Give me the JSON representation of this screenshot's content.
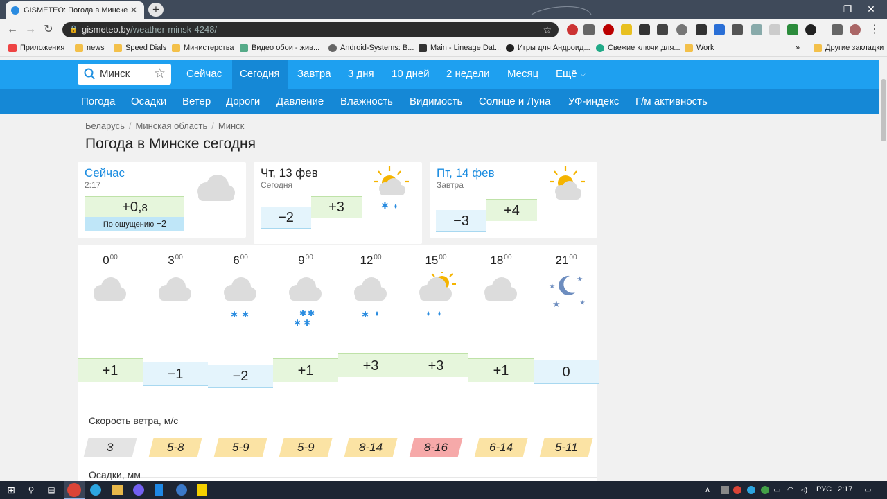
{
  "browser": {
    "tab_title": "GISMETEO: Погода в Минске сегодня",
    "url_host": "gismeteo.by",
    "url_path": "/weather-minsk-4248/",
    "bookmarks": [
      "Приложения",
      "news",
      "Speed Dials",
      "Министерства",
      "Видео обои - жив...",
      "Android-Systems: B...",
      "Main - Lineage Dat...",
      "Игры для Андроид...",
      "Свежие ключи для...",
      "Work"
    ],
    "other_bookmarks": "Другие закладки"
  },
  "site": {
    "search_value": "Минск",
    "top_nav": [
      "Сейчас",
      "Сегодня",
      "Завтра",
      "3 дня",
      "10 дней",
      "2 недели",
      "Месяц",
      "Ещё"
    ],
    "top_nav_active": "Сегодня",
    "sub_nav": [
      "Погода",
      "Осадки",
      "Ветер",
      "Дороги",
      "Давление",
      "Влажность",
      "Видимость",
      "Солнце и Луна",
      "УФ-индекс",
      "Г/м активность"
    ],
    "breadcrumb": [
      "Беларусь",
      "Минская область",
      "Минск"
    ],
    "page_title": "Погода в Минске сегодня"
  },
  "now_card": {
    "title": "Сейчас",
    "time": "2:17",
    "temp_int": "+0,",
    "temp_frac": "8",
    "feels_label": "По ощущению",
    "feels_value": "−2",
    "icon": "cloud-icon"
  },
  "today_card": {
    "title": "Чт, 13 фев",
    "subtitle": "Сегодня",
    "temp_min": "−2",
    "temp_max": "+3",
    "icon": "sun-cloud-snow-rain-icon"
  },
  "tomorrow_card": {
    "title": "Пт, 14 фев",
    "subtitle": "Завтра",
    "temp_min": "−3",
    "temp_max": "+4",
    "icon": "sun-cloud-icon"
  },
  "hourly": [
    {
      "hour": "0",
      "min": "00",
      "icon": "cloud-icon",
      "temp": "+1",
      "wind": "3"
    },
    {
      "hour": "3",
      "min": "00",
      "icon": "cloud-icon",
      "temp": "−1",
      "wind": "5-8"
    },
    {
      "hour": "6",
      "min": "00",
      "icon": "cloud-snow-icon",
      "temp": "−2",
      "wind": "5-9"
    },
    {
      "hour": "9",
      "min": "00",
      "icon": "cloud-heavy-snow-icon",
      "temp": "+1",
      "wind": "5-9"
    },
    {
      "hour": "12",
      "min": "00",
      "icon": "cloud-sleet-icon",
      "temp": "+3",
      "wind": "8-14"
    },
    {
      "hour": "15",
      "min": "00",
      "icon": "sun-cloud-rain-icon",
      "temp": "+3",
      "wind": "8-16"
    },
    {
      "hour": "18",
      "min": "00",
      "icon": "cloud-icon",
      "temp": "+1",
      "wind": "6-14"
    },
    {
      "hour": "21",
      "min": "00",
      "icon": "moon-stars-icon",
      "temp": "0",
      "wind": "5-11"
    }
  ],
  "wind_section": "Скорость ветра, м/с",
  "precip_section": "Осадки, мм",
  "taskbar": {
    "lang": "РУС",
    "time": "2:17"
  },
  "colors": {
    "nav_blue": "#1ea0f0",
    "nav_blue_dark": "#1588d6",
    "warm_bg": "#e6f6dc",
    "cold_bg": "#e4f4fc",
    "wind_calm": "#e4e4e4",
    "wind_moderate": "#fbe3a4",
    "wind_strong": "#f6a9a9"
  }
}
